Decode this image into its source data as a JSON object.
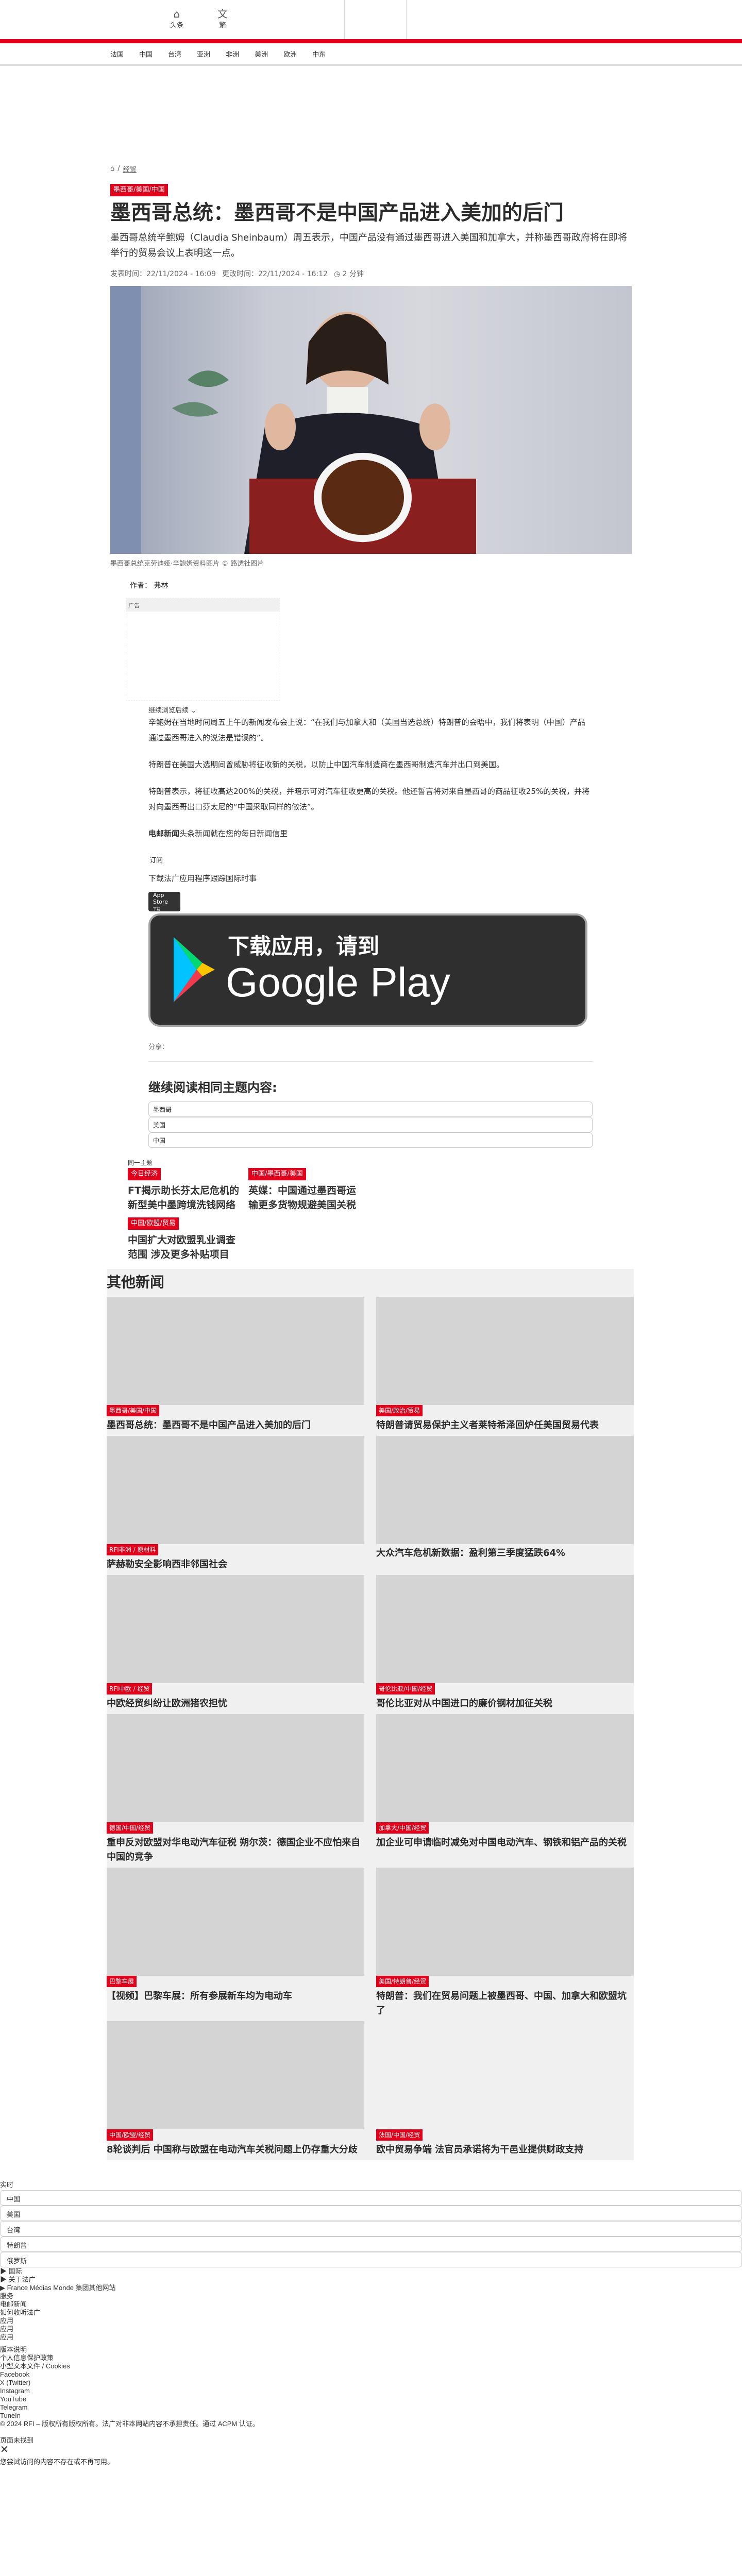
{
  "header": {
    "home_label": "头条",
    "lang_label": "繁",
    "nav": [
      "法国",
      "中国",
      "台湾",
      "亚洲",
      "非洲",
      "美洲",
      "欧洲",
      "中东"
    ]
  },
  "colors": {
    "accent": "#e2001a"
  },
  "breadcrumb": {
    "section": "经贸"
  },
  "article": {
    "tag": "墨西哥/美国/中国",
    "title": "墨西哥总统：墨西哥不是中国产品进入美加的后门",
    "lede": "墨西哥总统辛鲍姆（Claudia Sheinbaum）周五表示，中国产品没有通过墨西哥进入美国和加拿大，并称墨西哥政府将在即将举行的贸易会议上表明这一点。",
    "published_label": "发表时间：",
    "published": "22/11/2024 - 16:09",
    "modified_label": "更改时间：",
    "modified": "22/11/2024 - 16:12",
    "read_time": "2 分钟",
    "caption": "墨西哥总统克劳迪娅·辛鲍姆资料图片 © 路透社图片",
    "author": "作者： 弗林",
    "ad_label": "广告",
    "continue": "继续浏览后续",
    "paragraphs": [
      "辛鲍姆在当地时间周五上午的新闻发布会上说：“在我们与加拿大和（美国当选总统）特朗普的会晤中，我们将表明（中国）产品通过墨西哥进入的说法是错误的”。",
      "特朗普在美国大选期间曾威胁将征收新的关税，以防止中国汽车制造商在墨西哥制造汽车并出口到美国。",
      "特朗普表示，将征收高达200%的关税，并暗示可对汽车征收更高的关税。他还誓言将对来自墨西哥的商品征收25%的关税，并将对向墨西哥出口芬太尼的“中国采取同样的做法”。"
    ],
    "newsletter_bold": "电邮新闻",
    "newsletter_text": "头条新闻就在您的每日新闻信里",
    "subscribe": "订阅",
    "app_text": "下载法广应用程序跟踪国际时事",
    "appstore_label": "App Store",
    "appstore_sub": "下载",
    "gplay_line1": "下载应用，请到",
    "gplay_line2": "Google Play",
    "share_label": "分享："
  },
  "related": {
    "heading": "继续阅读相同主题内容:",
    "topics": [
      "墨西哥",
      "美国",
      "中国"
    ],
    "same_label": "同一主题",
    "items": [
      {
        "tag": "今日经济",
        "title": "FT揭示助长芬太尼危机的新型美中墨跨境洗钱网络"
      },
      {
        "tag": "中国/墨西哥/美国",
        "title": "英媒：中国通过墨西哥运输更多货物规避美国关税"
      },
      {
        "tag": "中国/欧盟/贸易",
        "title": "中国扩大对欧盟乳业调查范围 涉及更多补贴项目"
      }
    ]
  },
  "other_news": {
    "heading": "其他新闻",
    "items": [
      {
        "tag": "墨西哥/美国/中国",
        "title": "墨西哥总统：墨西哥不是中国产品进入美加的后门"
      },
      {
        "tag": "美国/政治/贸易",
        "title": "特朗普请贸易保护主义者莱特希泽回炉任美国贸易代表"
      },
      {
        "tag": "RFI非洲 / 原材料",
        "title": "萨赫勒安全影响西非邻国社会"
      },
      {
        "tag": "",
        "title": "大众汽车危机新数据：盈利第三季度猛跌64%"
      },
      {
        "tag": "RFI中欧 / 经贸",
        "title": "中欧经贸纠纷让欧洲猪农担忧"
      },
      {
        "tag": "哥伦比亚/中国/经贸",
        "title": "哥伦比亚对从中国进口的廉价钢材加征关税"
      },
      {
        "tag": "德国/中国/经贸",
        "title": "重申反对欧盟对华电动汽车征税 朔尔茨：德国企业不应怕来自中国的竞争"
      },
      {
        "tag": "加拿大/中国/经贸",
        "title": "加企业可申请临时减免对中国电动汽车、钢铁和铝产品的关税"
      },
      {
        "tag": "巴黎车展",
        "title": "【视频】巴黎车展：所有参展新车均为电动车"
      },
      {
        "tag": "美国/特朗普/经贸",
        "title": "特朗普：我们在贸易问题上被墨西哥、中国、加拿大和欧盟坑了"
      },
      {
        "tag": "中国/欧盟/经贸",
        "title": "8轮谈判后 中国称与欧盟在电动汽车关税问题上仍存重大分歧"
      },
      {
        "tag": "法国/中国/经贸",
        "title": "欧中贸易争端 法官员承诺将为干邑业提供财政支持"
      }
    ]
  },
  "footer": {
    "live_label": "实时",
    "live_topics": [
      "中国",
      "美国",
      "台湾",
      "特朗普",
      "俄罗斯"
    ],
    "sections": [
      "国际",
      "关于法广",
      "France Médias Monde 集团其他网站"
    ],
    "services_label": "服务",
    "services": [
      "电邮新闻",
      "如何收听法广",
      "应用",
      "应用",
      "应用"
    ],
    "legal": [
      "版本说明",
      "个人信息保护政策",
      "小型文本文件 / Cookies"
    ],
    "social": [
      "Facebook",
      "X (Twitter)",
      "Instagram",
      "YouTube",
      "Telegram",
      "TuneIn"
    ],
    "copyright": "© 2024 RFI – 版权所有版权所有。法广对非本网站内容不承担责任。通过 ACPM 认证。",
    "notfound_title": "页面未找到",
    "notfound_text": "您尝试访问的内容不存在或不再可用。"
  }
}
